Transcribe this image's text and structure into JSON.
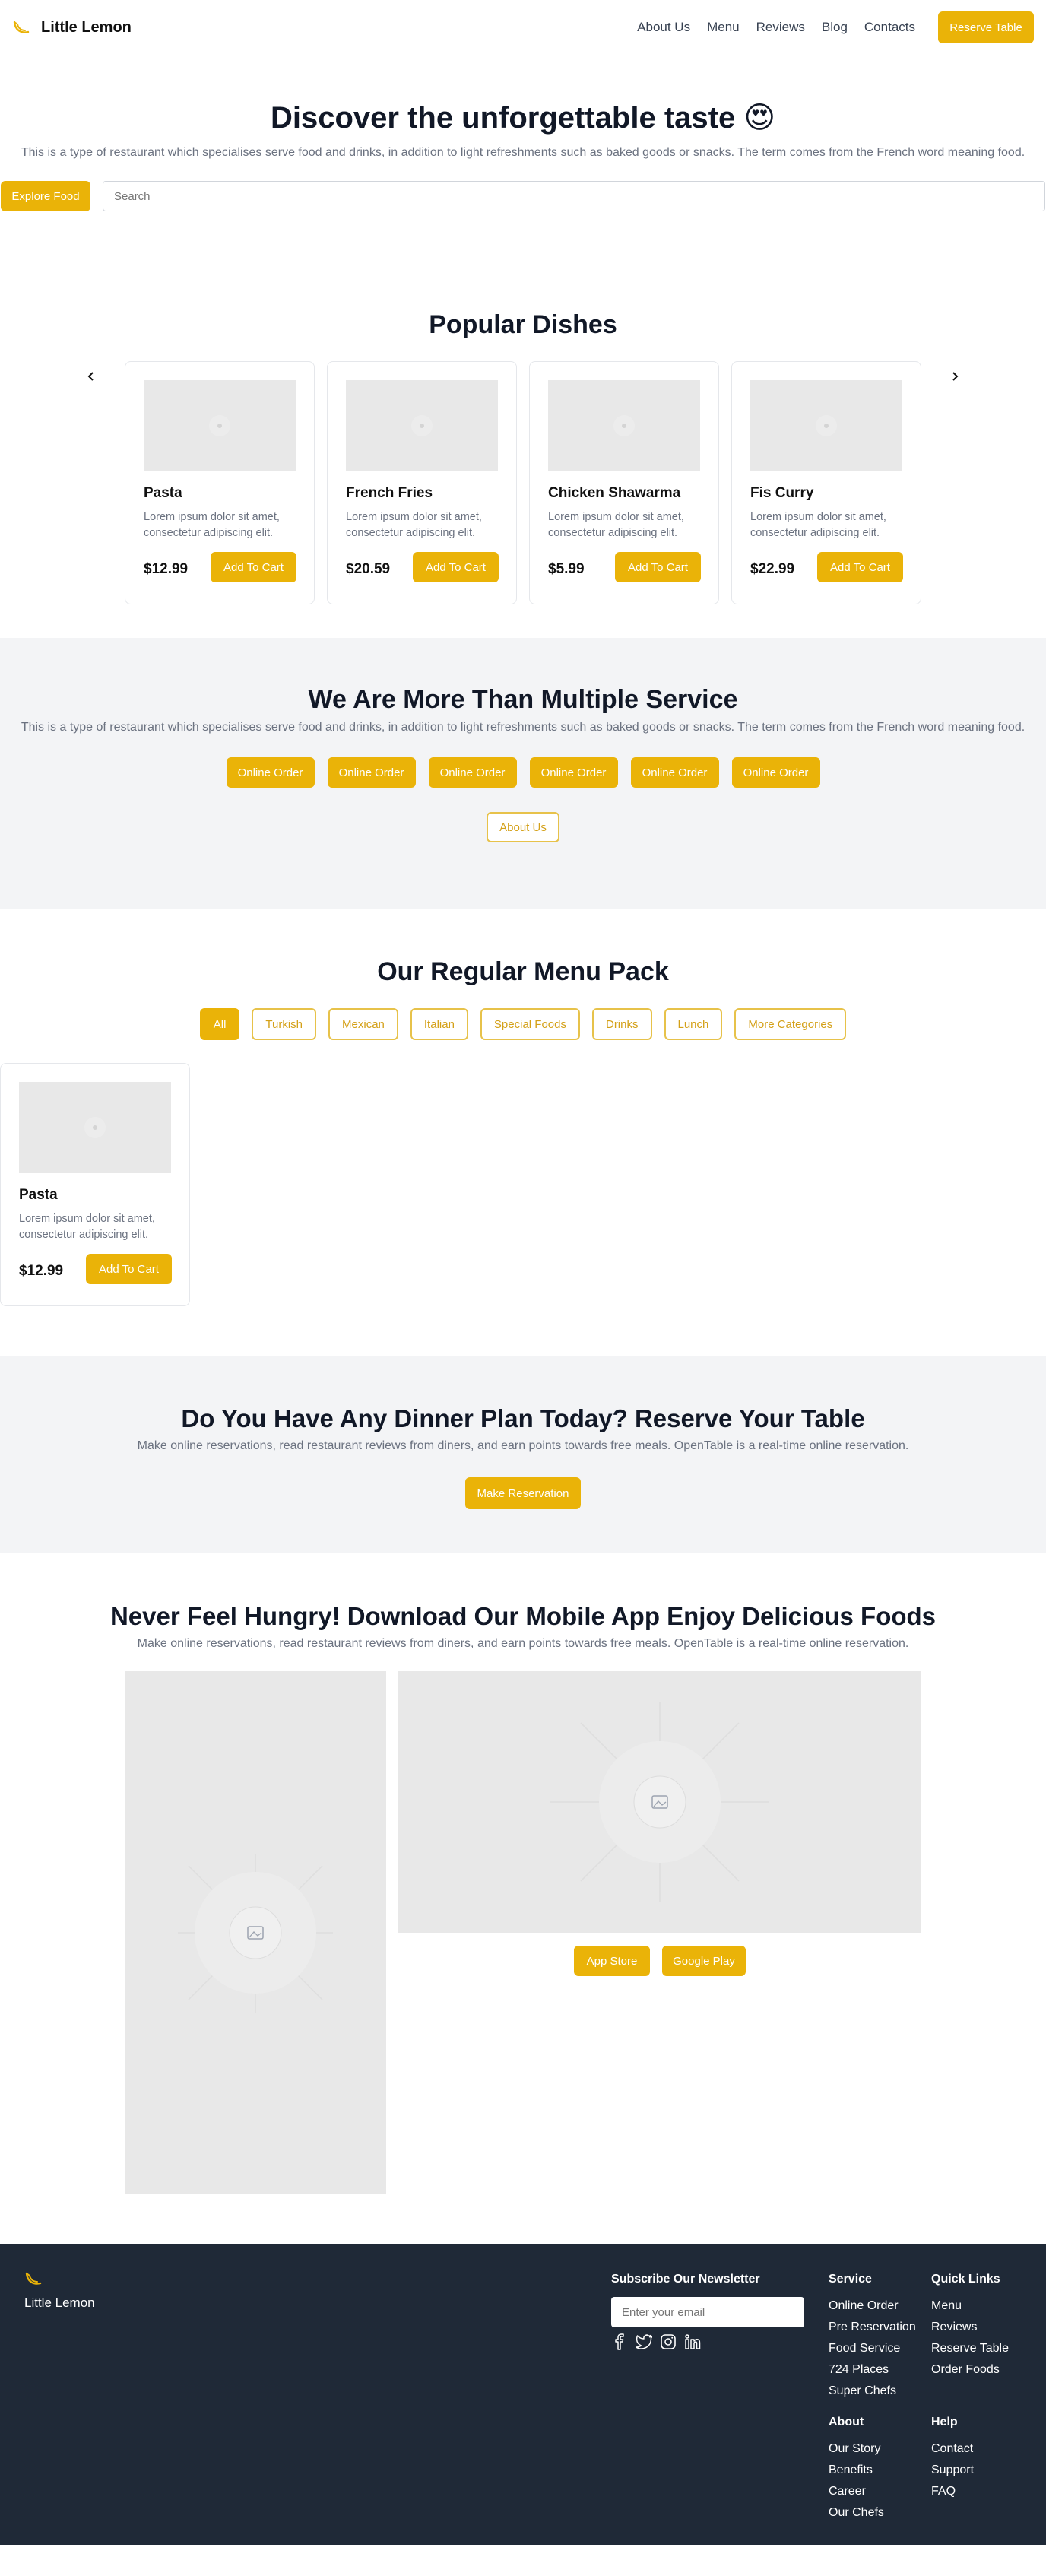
{
  "header": {
    "brand": "Little Lemon",
    "nav": [
      "About Us",
      "Menu",
      "Reviews",
      "Blog",
      "Contacts"
    ],
    "reserve_label": "Reserve Table"
  },
  "hero": {
    "title": "Discover the unforgettable taste 😍",
    "description": "This is a type of restaurant which specialises serve food and drinks, in addition to light refreshments such as baked goods or snacks. The term comes from the French word meaning food.",
    "explore_label": "Explore Food",
    "search_placeholder": "Search"
  },
  "popular": {
    "title": "Popular Dishes",
    "dishes": [
      {
        "name": "Pasta",
        "desc": "Lorem ipsum dolor sit amet, consectetur adipiscing elit.",
        "price": "$12.99",
        "button": "Add To Cart"
      },
      {
        "name": "French Fries",
        "desc": "Lorem ipsum dolor sit amet, consectetur adipiscing elit.",
        "price": "$20.59",
        "button": "Add To Cart"
      },
      {
        "name": "Chicken Shawarma",
        "desc": "Lorem ipsum dolor sit amet, consectetur adipiscing elit.",
        "price": "$5.99",
        "button": "Add To Cart"
      },
      {
        "name": "Fis Curry",
        "desc": "Lorem ipsum dolor sit amet, consectetur adipiscing elit.",
        "price": "$22.99",
        "button": "Add To Cart"
      }
    ]
  },
  "services": {
    "title": "We Are More Than Multiple Service",
    "description": "This is a type of restaurant which specialises serve food and drinks, in addition to light refreshments such as baked goods or snacks. The term comes from the French word meaning food.",
    "buttons": [
      "Online Order",
      "Online Order",
      "Online Order",
      "Online Order",
      "Online Order",
      "Online Order"
    ],
    "about_label": "About Us"
  },
  "menu_pack": {
    "title": "Our Regular Menu Pack",
    "filters": [
      "All",
      "Turkish",
      "Mexican",
      "Italian",
      "Special Foods",
      "Drinks",
      "Lunch",
      "More Categories"
    ],
    "active_filter": "All",
    "item": {
      "name": "Pasta",
      "desc": "Lorem ipsum dolor sit amet, consectetur adipiscing elit.",
      "price": "$12.99",
      "button": "Add To Cart"
    }
  },
  "reserve": {
    "title": "Do You Have Any Dinner Plan Today? Reserve Your Table",
    "description": "Make online reservations, read restaurant reviews from diners, and earn points towards free meals. OpenTable is a real-time online reservation.",
    "button": "Make Reservation"
  },
  "app": {
    "title": "Never Feel Hungry! Download Our Mobile App Enjoy Delicious Foods",
    "description": "Make online reservations, read restaurant reviews from diners, and earn points towards free meals. OpenTable is a real-time online reservation.",
    "app_store": "App Store",
    "google_play": "Google Play"
  },
  "footer": {
    "brand": "Little Lemon",
    "newsletter_title": "Subscribe Our Newsletter",
    "email_placeholder": "Enter your email",
    "social_icons": [
      "facebook-icon",
      "twitter-icon",
      "instagram-icon",
      "linkedin-icon"
    ],
    "service": {
      "title": "Service",
      "links": [
        "Online Order",
        "Pre Reservation",
        "Food Service",
        "724 Places",
        "Super Chefs"
      ]
    },
    "quick_links": {
      "title": "Quick Links",
      "links": [
        "Menu",
        "Reviews",
        "Reserve Table",
        "Order Foods"
      ]
    },
    "about": {
      "title": "About",
      "links": [
        "Our Story",
        "Benefits",
        "Career",
        "Our Chefs"
      ]
    },
    "help": {
      "title": "Help",
      "links": [
        "Contact",
        "Support",
        "FAQ"
      ]
    }
  },
  "colors": {
    "accent": "#eab308",
    "footer_bg": "#1f2937",
    "section_bg": "#f3f4f6"
  }
}
